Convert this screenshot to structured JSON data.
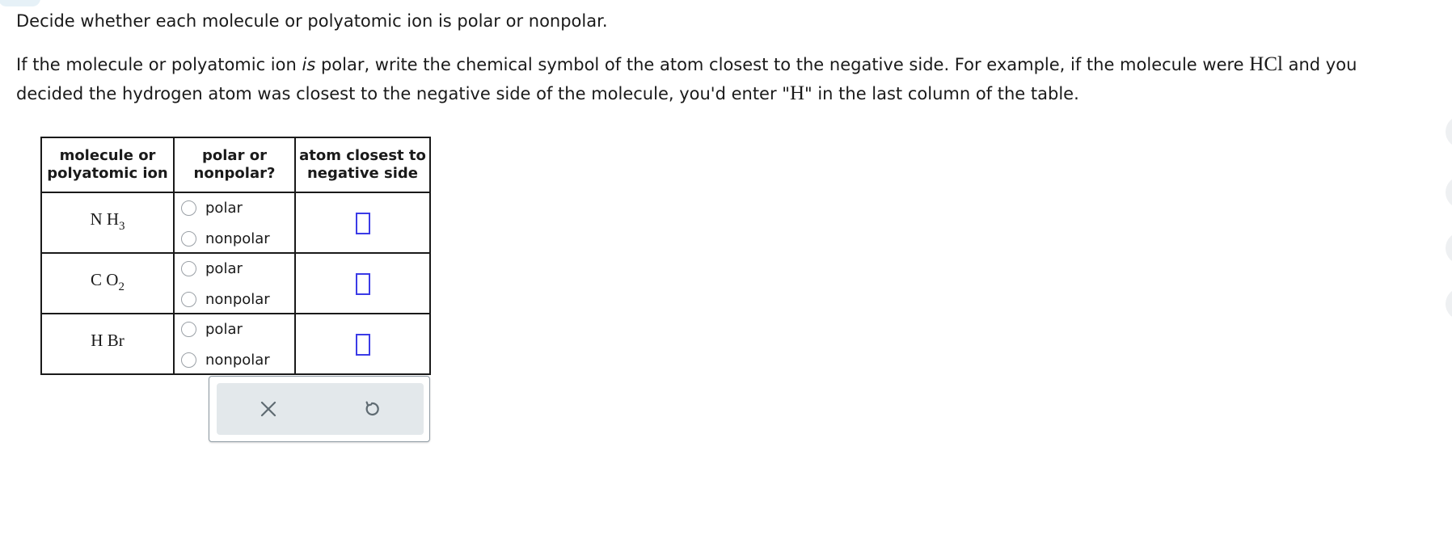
{
  "instructions": {
    "line1": "Decide whether each molecule or polyatomic ion is polar or nonpolar.",
    "p2_before_is": "If the molecule or polyatomic ion ",
    "p2_is": "is",
    "p2_after_is": " polar, write the chemical symbol of the atom closest to the negative side. For example, if the molecule were ",
    "example_molecule": "HCl",
    "p2_middle": " and you decided the hydrogen atom was closest to the negative side of the molecule, you'd enter \"",
    "example_atom": "H",
    "p2_end": "\" in the last column of the table."
  },
  "table": {
    "headers": {
      "col1_line1": "molecule or",
      "col1_line2": "polyatomic ion",
      "col2_line1": "polar or",
      "col2_line2": "nonpolar?",
      "col3_line1": "atom closest to",
      "col3_line2": "negative side"
    },
    "rows": [
      {
        "formula_main": "N H",
        "formula_sub": "3",
        "option_polar": "polar",
        "option_nonpolar": "nonpolar",
        "atom_value": ""
      },
      {
        "formula_main": "C O",
        "formula_sub": "2",
        "option_polar": "polar",
        "option_nonpolar": "nonpolar",
        "atom_value": ""
      },
      {
        "formula_main": "H Br",
        "formula_sub": "",
        "option_polar": "polar",
        "option_nonpolar": "nonpolar",
        "atom_value": ""
      }
    ]
  },
  "actions": {
    "clear_icon": "close-icon",
    "reset_icon": "undo-icon",
    "icon_color": "#5f6b72"
  },
  "colors": {
    "answer_box_border": "#3b3be6",
    "panel_background": "#e3e8eb"
  }
}
